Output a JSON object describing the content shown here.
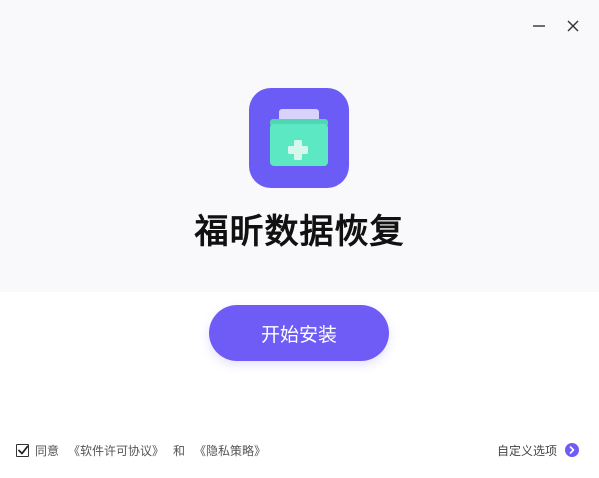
{
  "window": {
    "minimize_icon": "minimize-icon",
    "close_icon": "close-icon"
  },
  "app": {
    "title": "福昕数据恢复",
    "icon": "medical-kit-icon"
  },
  "install_button": {
    "label": "开始安装"
  },
  "footer": {
    "agree_label": "同意",
    "license_link": "《软件许可协议》",
    "and_label": "和",
    "privacy_link": "《隐私策略》",
    "custom_options_label": "自定义选项",
    "custom_options_icon": "chevron-right-circle-icon",
    "agreement_checked": true
  },
  "colors": {
    "accent": "#6f5cf7",
    "icon_background": "#6b5cf6",
    "kit_body": "#5de8c4",
    "kit_lid": "#d7d3fb",
    "top_area_background": "#f9f9fb"
  }
}
